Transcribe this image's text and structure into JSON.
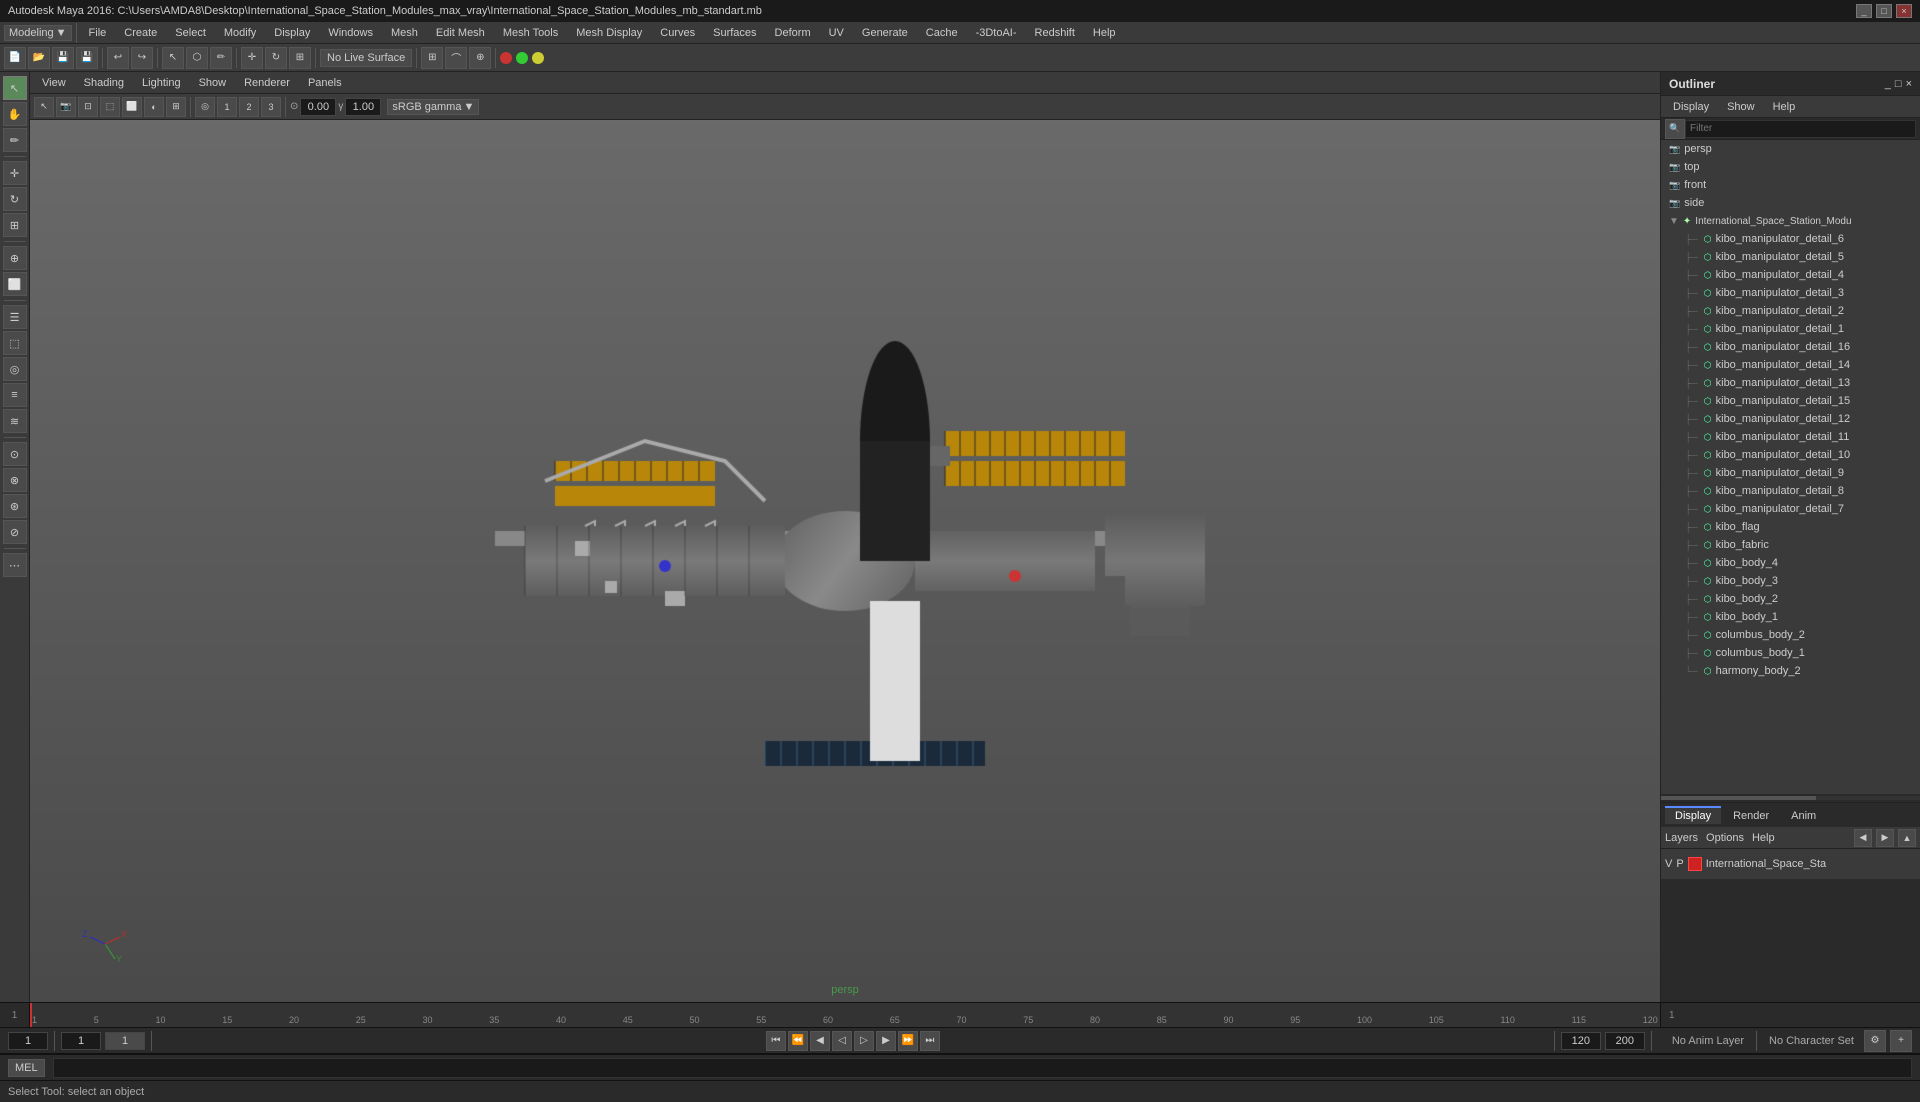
{
  "titleBar": {
    "title": "Autodesk Maya 2016: C:\\Users\\AMDA8\\Desktop\\International_Space_Station_Modules_max_vray\\International_Space_Station_Modules_mb_standart.mb",
    "controls": [
      "_",
      "□",
      "×"
    ]
  },
  "menuBar": {
    "items": [
      "File",
      "Create",
      "Select",
      "Modify",
      "Display",
      "Windows",
      "Mesh",
      "Edit Mesh",
      "Mesh Tools",
      "Mesh Display",
      "Curves",
      "Surfaces",
      "Deform",
      "UV",
      "Generate",
      "Cache",
      "-3DtoAI-",
      "Redshift",
      "Help"
    ]
  },
  "modeDropdown": "Modeling",
  "toolbar": {
    "liveSurface": "No Live Surface",
    "colorSpace": "sRGB gamma",
    "value1": "0.00",
    "value2": "1.00"
  },
  "viewportMenu": {
    "items": [
      "View",
      "Shading",
      "Lighting",
      "Show",
      "Renderer",
      "Panels"
    ]
  },
  "viewportLabel": "persp",
  "outliner": {
    "title": "Outliner",
    "menuItems": [
      "Display",
      "Show",
      "Help"
    ],
    "cameras": [
      "persp",
      "top",
      "front",
      "side"
    ],
    "rootNode": "International_Space_Station_Modu",
    "meshItems": [
      "kibo_manipulator_detail_6",
      "kibo_manipulator_detail_5",
      "kibo_manipulator_detail_4",
      "kibo_manipulator_detail_3",
      "kibo_manipulator_detail_2",
      "kibo_manipulator_detail_1",
      "kibo_manipulator_detail_16",
      "kibo_manipulator_detail_14",
      "kibo_manipulator_detail_13",
      "kibo_manipulator_detail_15",
      "kibo_manipulator_detail_12",
      "kibo_manipulator_detail_11",
      "kibo_manipulator_detail_10",
      "kibo_manipulator_detail_9",
      "kibo_manipulator_detail_8",
      "kibo_manipulator_detail_7",
      "kibo_flag",
      "kibo_fabric",
      "kibo_body_4",
      "kibo_body_3",
      "kibo_body_2",
      "kibo_body_1",
      "columbus_body_2",
      "columbus_body_1",
      "harmony_body_2"
    ]
  },
  "bottomPanel": {
    "tabs": [
      "Display",
      "Render",
      "Anim"
    ],
    "activeTab": "Display",
    "rows": [
      "Layers",
      "Options",
      "Help"
    ],
    "colorLabel": "V  P",
    "layerName": "International_Space_Sta"
  },
  "timeline": {
    "start": 1,
    "end": 120,
    "ticks": [
      1,
      5,
      10,
      15,
      20,
      25,
      30,
      35,
      40,
      45,
      50,
      55,
      60,
      65,
      70,
      75,
      80,
      85,
      90,
      95,
      100,
      105,
      110,
      115,
      120
    ],
    "currentFrame": 1
  },
  "playback": {
    "startFrame": "1",
    "endFrame": "120",
    "rangeStart": "1",
    "rangeEnd": "200",
    "animLayer": "No Anim Layer",
    "characterSet": "No Character Set"
  },
  "scriptBar": {
    "type": "MEL",
    "statusText": "Select Tool: select an object"
  },
  "leftSidebar": {
    "tools": [
      "↖",
      "✋",
      "↺",
      "⟲",
      "⊞",
      "⬜",
      "◎",
      "⬛",
      "⬜",
      "⬚",
      "⊕",
      "⊗",
      "⊙",
      "⊘",
      "⊛",
      "⊜"
    ]
  }
}
